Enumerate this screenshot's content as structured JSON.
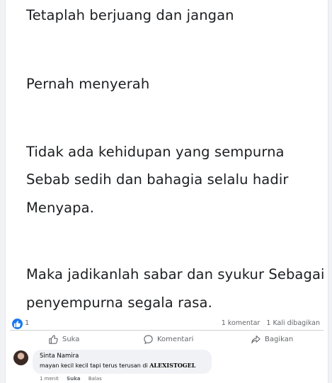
{
  "post": {
    "lines": [
      "Tetaplah berjuang dan jangan",
      "Pernah menyerah",
      "Tidak ada kehidupan yang sempurna",
      "Sebab sedih dan bahagia selalu hadir",
      "Menyapa.",
      "Maka jadikanlah sabar dan syukur Sebagai",
      "penyempurna segala rasa."
    ]
  },
  "stats": {
    "reaction_count": "1",
    "comments": "1 komentar",
    "shares": "1 Kali dibagikan"
  },
  "actions": {
    "like": "Suka",
    "comment": "Komentari",
    "share": "Bagikan"
  },
  "comment": {
    "author": "Sinta Namira",
    "text": "mayan kecil kecil tapi terus terusan di ",
    "brand": "ALEXISTOGEL",
    "time": "1 menit",
    "like": "Suka",
    "reply": "Balas"
  },
  "colors": {
    "accent": "#1877f2",
    "secondary_text": "#65676b",
    "background": "#f0f2f5"
  },
  "icons": [
    "like-icon",
    "thumbs-up-icon",
    "comment-icon",
    "share-icon"
  ]
}
